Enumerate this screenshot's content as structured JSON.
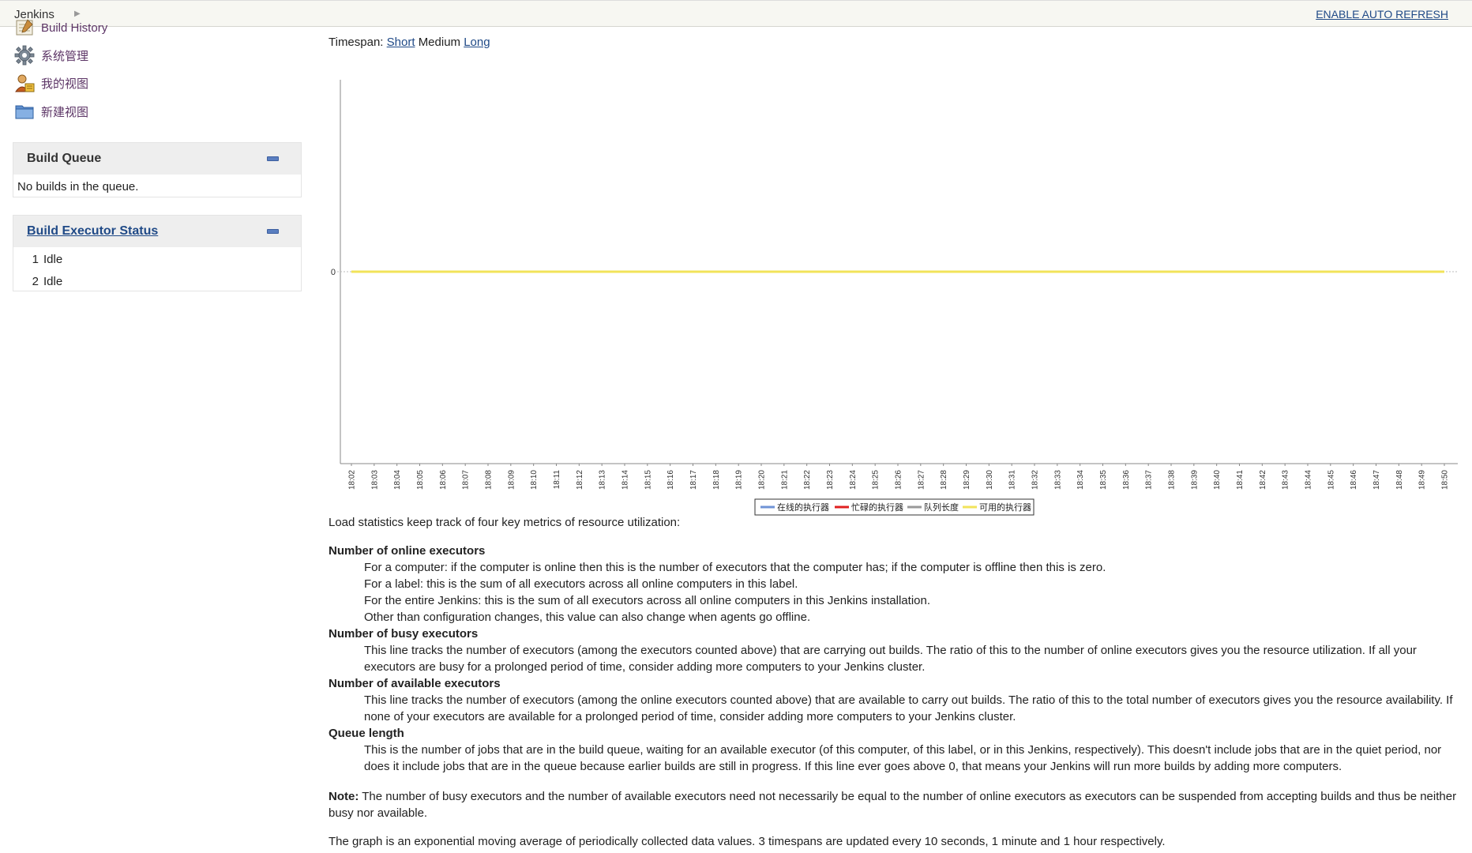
{
  "header": {
    "home": "Jenkins",
    "auto_refresh": "ENABLE AUTO REFRESH"
  },
  "sidebar": {
    "tasks": [
      {
        "label": "Build History",
        "icon": "notepad-icon"
      },
      {
        "label": "系统管理",
        "icon": "gear-icon"
      },
      {
        "label": "我的视图",
        "icon": "user-views-icon"
      },
      {
        "label": "新建视图",
        "icon": "folder-icon"
      }
    ],
    "build_queue": {
      "title": "Build Queue",
      "empty_text": "No builds in the queue."
    },
    "executor_status": {
      "title": "Build Executor Status",
      "executors": [
        {
          "number": "1",
          "status": "Idle"
        },
        {
          "number": "2",
          "status": "Idle"
        }
      ]
    }
  },
  "timespan": {
    "label": "Timespan:",
    "short": "Short",
    "medium": "Medium",
    "long": "Long"
  },
  "chart_data": {
    "type": "line",
    "title": "",
    "xlabel": "",
    "ylabel": "",
    "y_tick_labels": [
      "0"
    ],
    "x": [
      "18:02",
      "18:03",
      "18:04",
      "18:05",
      "18:06",
      "18:07",
      "18:08",
      "18:09",
      "18:10",
      "18:11",
      "18:12",
      "18:13",
      "18:14",
      "18:15",
      "18:16",
      "18:17",
      "18:18",
      "18:19",
      "18:20",
      "18:21",
      "18:22",
      "18:23",
      "18:24",
      "18:25",
      "18:26",
      "18:27",
      "18:28",
      "18:29",
      "18:30",
      "18:31",
      "18:32",
      "18:33",
      "18:34",
      "18:35",
      "18:36",
      "18:37",
      "18:38",
      "18:39",
      "18:40",
      "18:41",
      "18:42",
      "18:43",
      "18:44",
      "18:45",
      "18:46",
      "18:47",
      "18:48",
      "18:49",
      "18:50"
    ],
    "ylim": [
      -1,
      1
    ],
    "grid": false,
    "legend_position": "bottom",
    "series": [
      {
        "name": "在线的执行器",
        "color": "#6f93d6",
        "values": [
          0,
          0,
          0,
          0,
          0,
          0,
          0,
          0,
          0,
          0,
          0,
          0,
          0,
          0,
          0,
          0,
          0,
          0,
          0,
          0,
          0,
          0,
          0,
          0,
          0,
          0,
          0,
          0,
          0,
          0,
          0,
          0,
          0,
          0,
          0,
          0,
          0,
          0,
          0,
          0,
          0,
          0,
          0,
          0,
          0,
          0,
          0,
          0,
          0
        ]
      },
      {
        "name": "忙碌的执行器",
        "color": "#e02020",
        "values": [
          0,
          0,
          0,
          0,
          0,
          0,
          0,
          0,
          0,
          0,
          0,
          0,
          0,
          0,
          0,
          0,
          0,
          0,
          0,
          0,
          0,
          0,
          0,
          0,
          0,
          0,
          0,
          0,
          0,
          0,
          0,
          0,
          0,
          0,
          0,
          0,
          0,
          0,
          0,
          0,
          0,
          0,
          0,
          0,
          0,
          0,
          0,
          0,
          0
        ]
      },
      {
        "name": "队列长度",
        "color": "#999999",
        "values": [
          0,
          0,
          0,
          0,
          0,
          0,
          0,
          0,
          0,
          0,
          0,
          0,
          0,
          0,
          0,
          0,
          0,
          0,
          0,
          0,
          0,
          0,
          0,
          0,
          0,
          0,
          0,
          0,
          0,
          0,
          0,
          0,
          0,
          0,
          0,
          0,
          0,
          0,
          0,
          0,
          0,
          0,
          0,
          0,
          0,
          0,
          0,
          0,
          0
        ]
      },
      {
        "name": "可用的执行器",
        "color": "#f2e35a",
        "values": [
          0,
          0,
          0,
          0,
          0,
          0,
          0,
          0,
          0,
          0,
          0,
          0,
          0,
          0,
          0,
          0,
          0,
          0,
          0,
          0,
          0,
          0,
          0,
          0,
          0,
          0,
          0,
          0,
          0,
          0,
          0,
          0,
          0,
          0,
          0,
          0,
          0,
          0,
          0,
          0,
          0,
          0,
          0,
          0,
          0,
          0,
          0,
          0,
          0
        ]
      }
    ]
  },
  "description": {
    "intro": "Load statistics keep track of four key metrics of resource utilization:",
    "online_title": "Number of online executors",
    "online_lines": [
      "For a computer: if the computer is online then this is the number of executors that the computer has; if the computer is offline then this is zero.",
      "For a label: this is the sum of all executors across all online computers in this label.",
      "For the entire Jenkins: this is the sum of all executors across all online computers in this Jenkins installation.",
      "Other than configuration changes, this value can also change when agents go offline."
    ],
    "busy_title": "Number of busy executors",
    "busy_text": "This line tracks the number of executors (among the executors counted above) that are carrying out builds. The ratio of this to the number of online executors gives you the resource utilization. If all your executors are busy for a prolonged period of time, consider adding more computers to your Jenkins cluster.",
    "available_title": "Number of available executors",
    "available_text": "This line tracks the number of executors (among the online executors counted above) that are available to carry out builds. The ratio of this to the total number of executors gives you the resource availability. If none of your executors are available for a prolonged period of time, consider adding more computers to your Jenkins cluster.",
    "queue_title": "Queue length",
    "queue_text": "This is the number of jobs that are in the build queue, waiting for an available executor (of this computer, of this label, or in this Jenkins, respectively). This doesn't include jobs that are in the quiet period, nor does it include jobs that are in the queue because earlier builds are still in progress. If this line ever goes above 0, that means your Jenkins will run more builds by adding more computers.",
    "note_label": "Note:",
    "note_text": " The number of busy executors and the number of available executors need not necessarily be equal to the number of online executors as executors can be suspended from accepting builds and thus be neither busy nor available.",
    "footer": "The graph is an exponential moving average of periodically collected data values. 3 timespans are updated every 10 seconds, 1 minute and 1 hour respectively."
  }
}
